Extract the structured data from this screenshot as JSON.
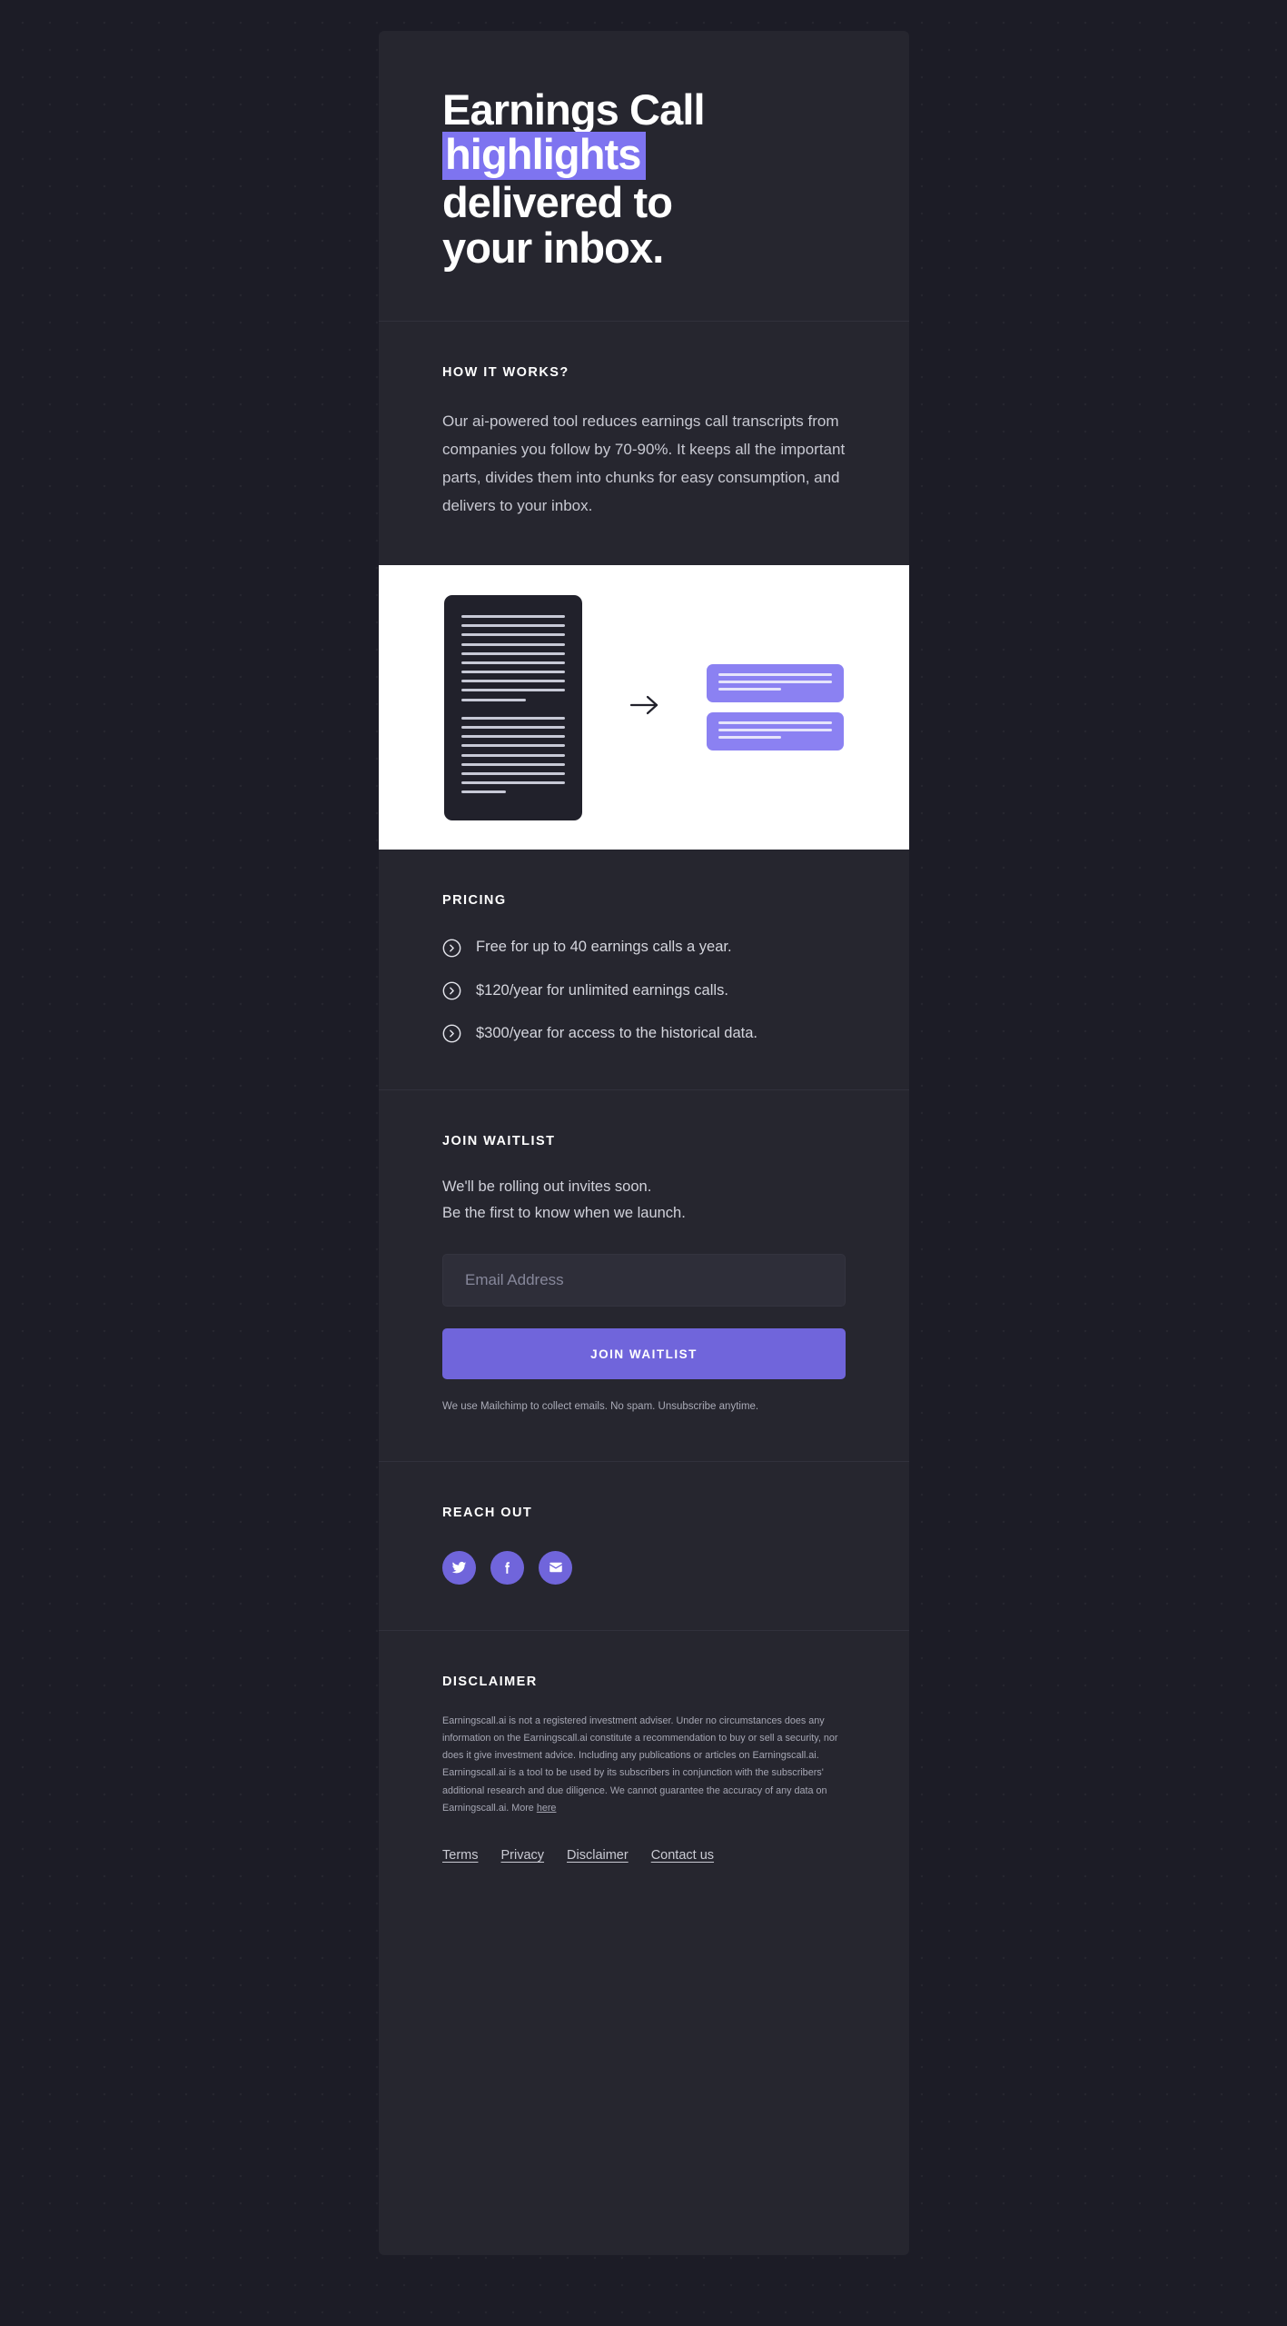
{
  "hero": {
    "line1": "Earnings Call",
    "line2_highlight": "highlights",
    "line3": "delivered to",
    "line4": "your inbox."
  },
  "how_it_works": {
    "eyebrow": "HOW IT WORKS?",
    "body": "Our ai-powered tool reduces earnings call transcripts from companies you follow by 70-90%. It keeps all the important parts, divides them into chunks for easy consumption, and delivers to your inbox."
  },
  "illustration": {
    "source_doc_name": "transcript-document",
    "arrow_name": "arrow-right-icon",
    "output_card_count": 2
  },
  "pricing": {
    "eyebrow": "PRICING",
    "items": [
      {
        "icon": "chevron-right-circle-icon",
        "text": "Free for up to 40 earnings calls a year."
      },
      {
        "icon": "chevron-right-circle-icon",
        "text": "$120/year for unlimited earnings calls."
      },
      {
        "icon": "chevron-right-circle-icon",
        "text": "$300/year for access to the historical data."
      }
    ]
  },
  "waitlist": {
    "eyebrow": "JOIN WAITLIST",
    "line1": "We'll be rolling out invites soon.",
    "line2": "Be the first to know when we launch.",
    "email_placeholder": "Email Address",
    "email_value": "",
    "cta_label": "JOIN WAITLIST",
    "fine_print": "We use Mailchimp to collect emails. No spam. Unsubscribe anytime."
  },
  "reach_out": {
    "eyebrow": "REACH OUT",
    "socials": [
      {
        "name": "twitter",
        "icon": "twitter-icon"
      },
      {
        "name": "facebook",
        "icon": "facebook-icon"
      },
      {
        "name": "email",
        "icon": "envelope-icon"
      }
    ]
  },
  "disclaimer": {
    "eyebrow": "DISCLAIMER",
    "body": "Earningscall.ai is not a registered investment adviser. Under no circumstances does any information on the Earningscall.ai constitute a recommendation to buy or sell a security, nor does it give investment advice. Including any publications or articles on Earningscall.ai. Earningscall.ai is a tool to be used by its subscribers in conjunction with the subscribers' additional research and due diligence. We cannot guarantee the accuracy of any data on Earningscall.ai. More ",
    "more_link": "here"
  },
  "footer": {
    "links": [
      "Terms",
      "Privacy",
      "Disclaimer",
      "Contact us"
    ]
  },
  "colors": {
    "page_bg": "#1c1c26",
    "card_bg": "#26262f",
    "accent_purple": "#7065db",
    "highlight_purple": "#7e74f0",
    "illustration_bg": "#ffffff"
  }
}
